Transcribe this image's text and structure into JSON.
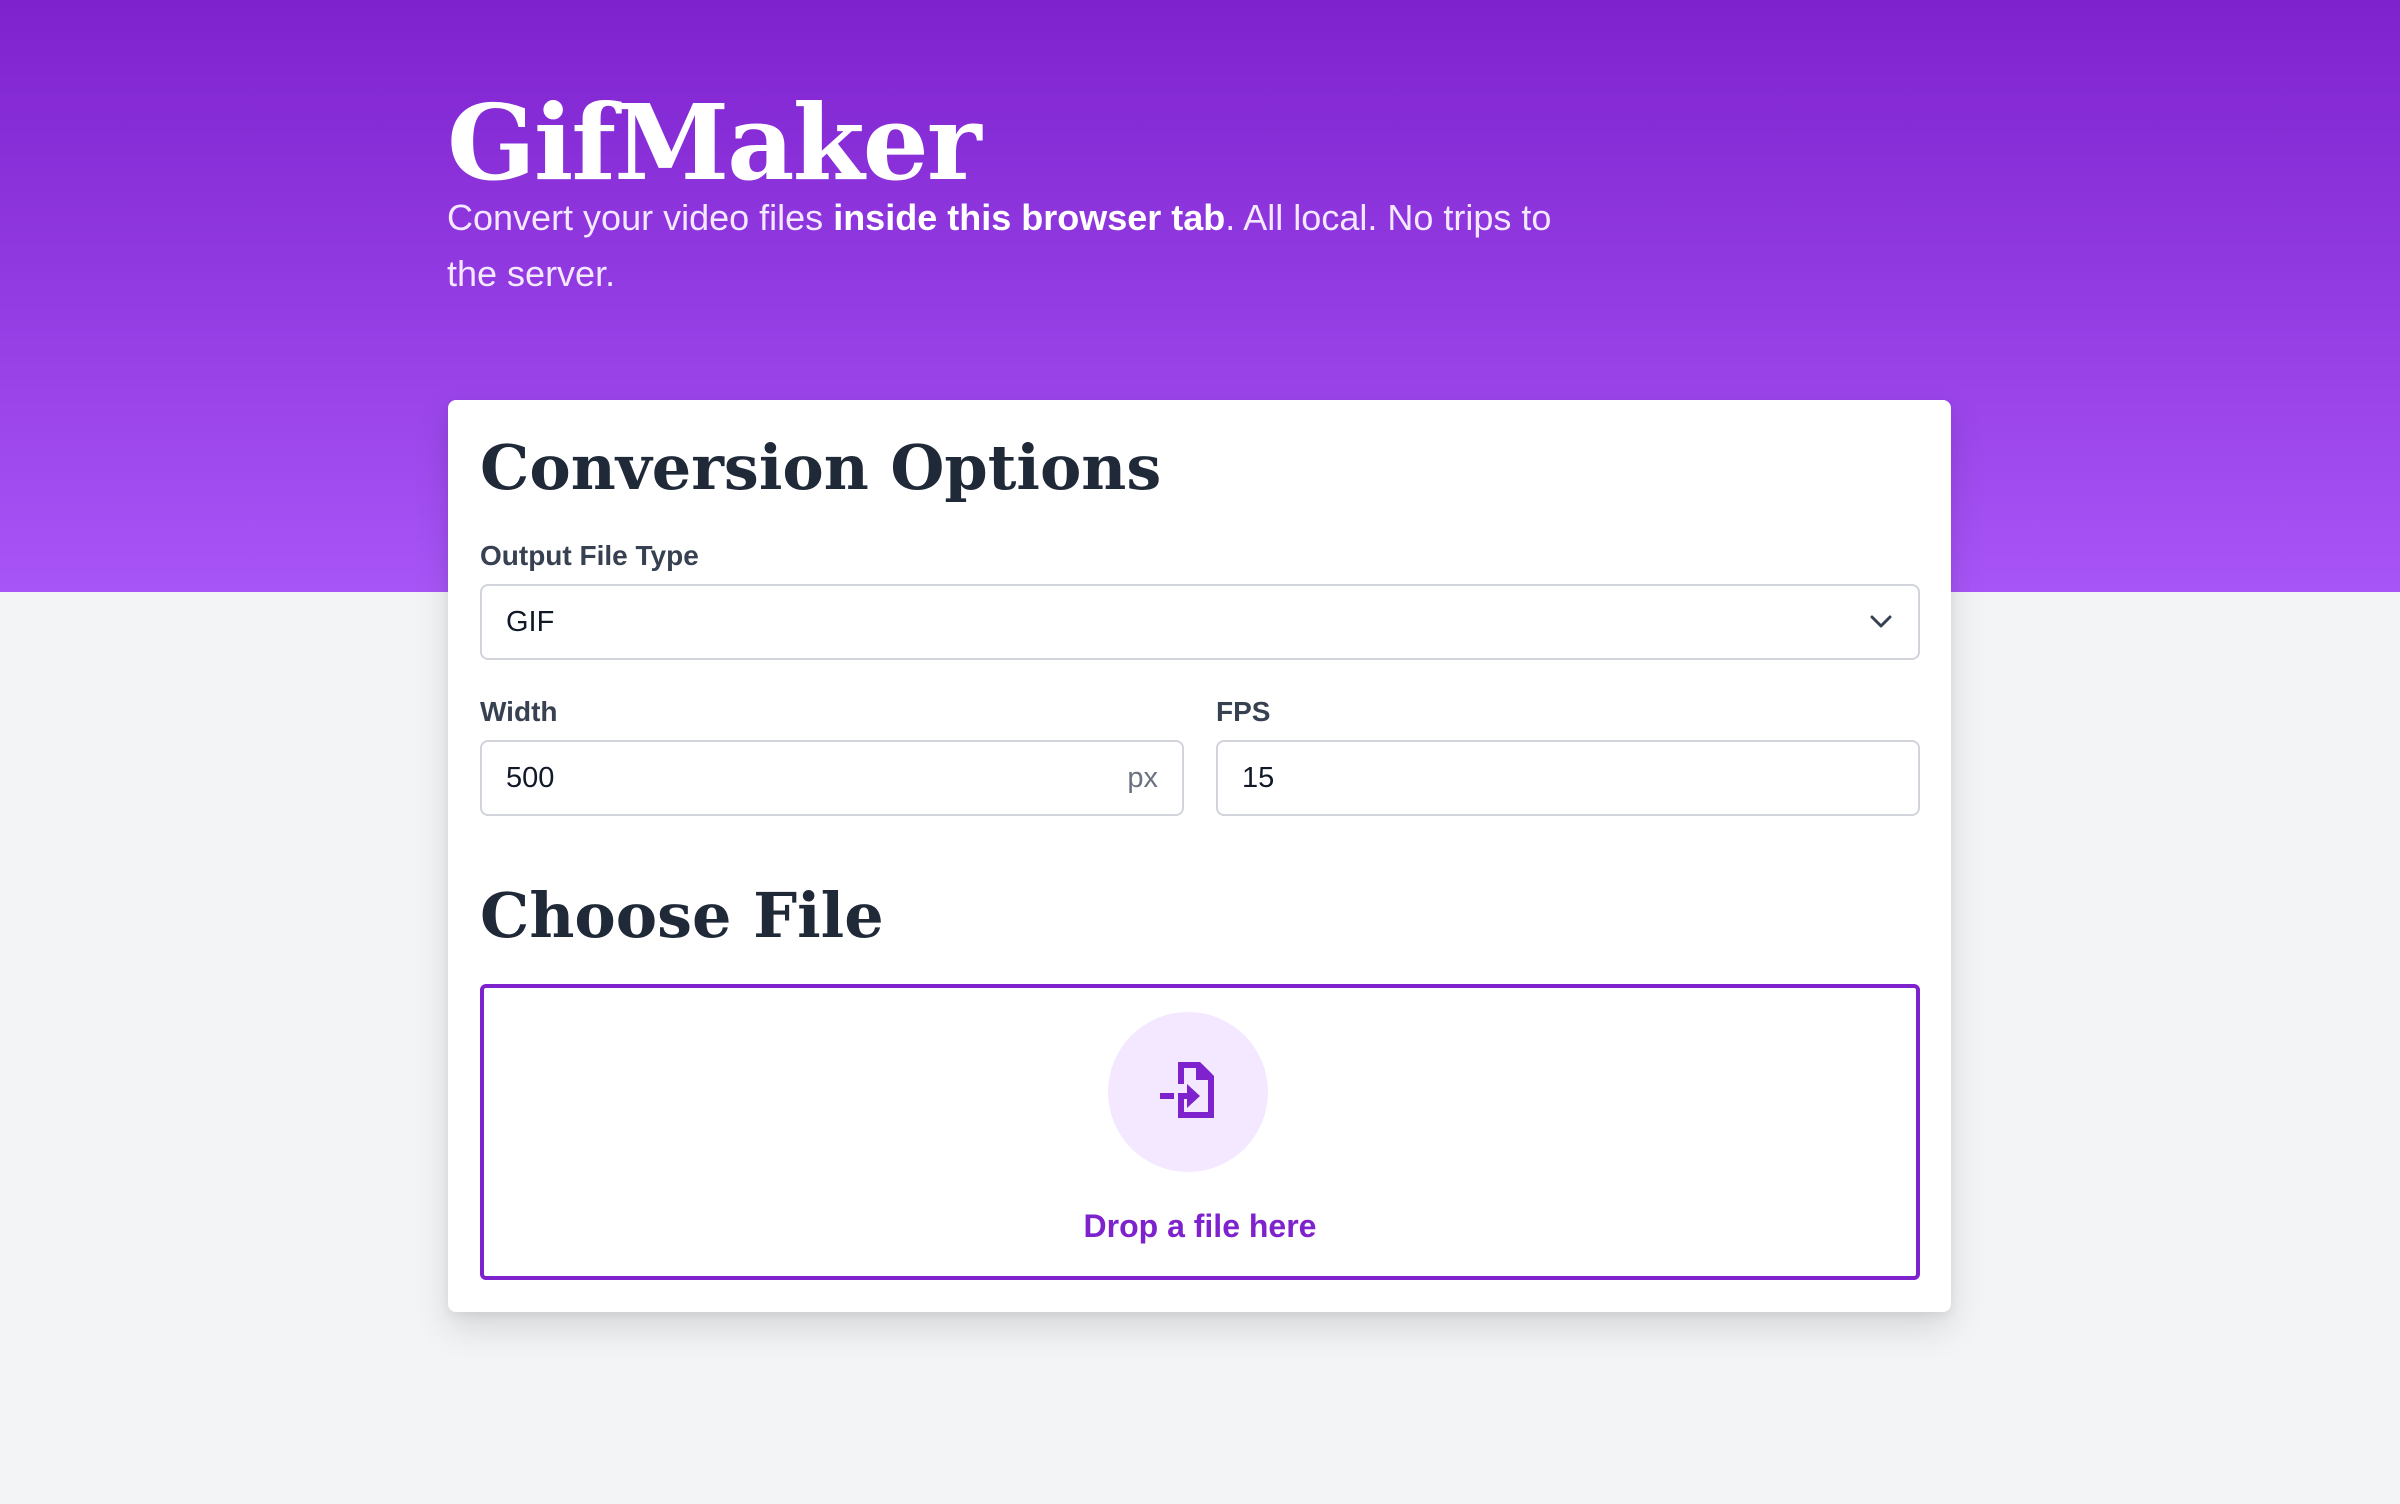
{
  "header": {
    "title": "GifMaker",
    "subtitle_start": "Convert your video files ",
    "subtitle_emphasis": "inside this browser tab",
    "subtitle_end": ". All local. No trips to the server."
  },
  "options": {
    "heading": "Conversion Options",
    "output_type_label": "Output File Type",
    "output_type_value": "GIF",
    "width_label": "Width",
    "width_value": "500",
    "width_unit": "px",
    "fps_label": "FPS",
    "fps_value": "15"
  },
  "file": {
    "heading": "Choose File",
    "drop_label": "Drop a file here"
  },
  "colors": {
    "accent": "#7e22ce",
    "accent_light": "#a855f7",
    "icon_bg": "#f3e8ff",
    "heading_text": "#1f2937",
    "page_bg": "#f3f4f6"
  },
  "icons": {
    "select_arrow": "chevron-down-icon",
    "drop_icon": "file-import-icon"
  }
}
